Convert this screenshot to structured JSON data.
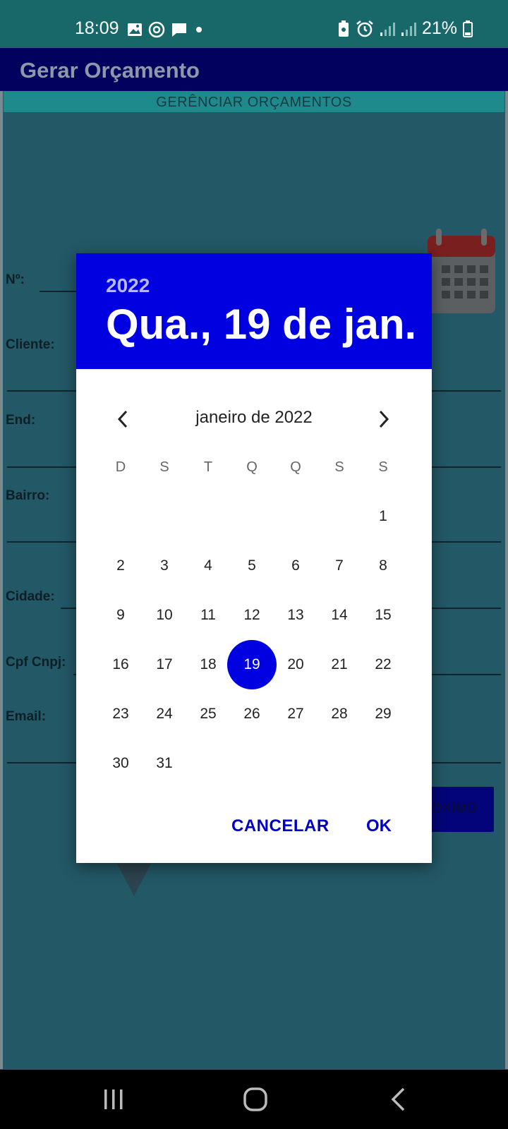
{
  "status_bar": {
    "time": "18:09",
    "battery": "21%",
    "left_icons": [
      "image-icon",
      "sync-icon",
      "message-icon",
      "dot-icon"
    ],
    "right_icons": [
      "battery-saver-icon",
      "alarm-icon",
      "signal-icon",
      "signal-icon-2",
      "battery-icon"
    ]
  },
  "app_bar": {
    "title": "Gerar Orçamento"
  },
  "manage_link": "GERÊNCIAR ORÇAMENTOS",
  "form": {
    "number_label": "Nº:",
    "client_label": "Cliente:",
    "address_label": "End:",
    "neighborhood_label": "Bairro:",
    "city_label": "Cidade:",
    "cpf_label": "Cpf Cnpj:",
    "email_label": "Email:",
    "next_button": "ÓXIMO"
  },
  "date_picker": {
    "year": "2022",
    "selected_date_text": "Qua., 19 de jan.",
    "month_label": "janeiro de 2022",
    "weekdays": [
      "D",
      "S",
      "T",
      "Q",
      "Q",
      "S",
      "S"
    ],
    "weeks": [
      [
        "",
        "",
        "",
        "",
        "",
        "",
        "1"
      ],
      [
        "2",
        "3",
        "4",
        "5",
        "6",
        "7",
        "8"
      ],
      [
        "9",
        "10",
        "11",
        "12",
        "13",
        "14",
        "15"
      ],
      [
        "16",
        "17",
        "18",
        "19",
        "20",
        "21",
        "22"
      ],
      [
        "23",
        "24",
        "25",
        "26",
        "27",
        "28",
        "29"
      ],
      [
        "30",
        "31",
        "",
        "",
        "",
        "",
        ""
      ]
    ],
    "selected_day": "19",
    "cancel_label": "CANCELAR",
    "ok_label": "OK"
  },
  "colors": {
    "accent": "#0000e0",
    "app_bar": "#02025e",
    "status_bar": "#18686a"
  }
}
